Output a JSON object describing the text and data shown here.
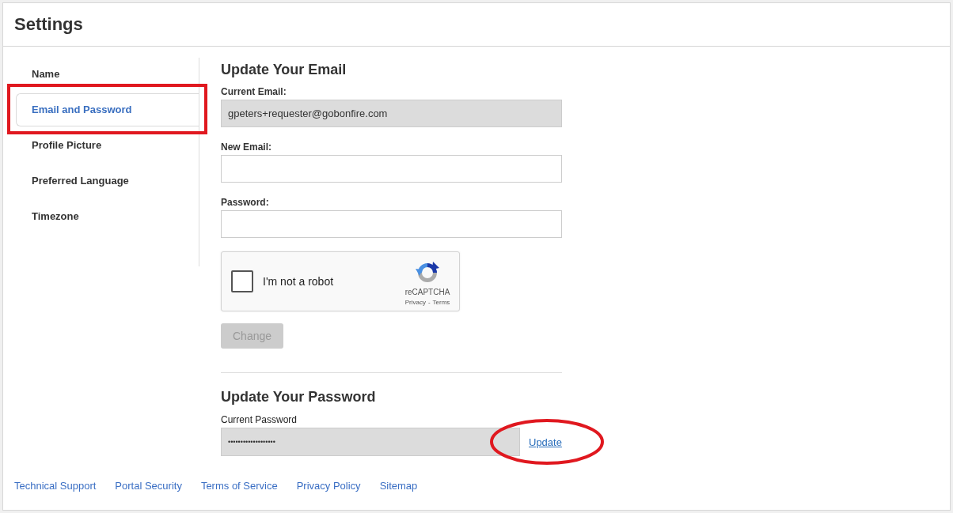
{
  "header": {
    "title": "Settings"
  },
  "sidebar": {
    "items": [
      {
        "label": "Name",
        "selected": false,
        "marked": false
      },
      {
        "label": "Email and Password",
        "selected": true,
        "marked": true
      },
      {
        "label": "Profile Picture",
        "selected": false,
        "marked": false
      },
      {
        "label": "Preferred Language",
        "selected": false,
        "marked": false
      },
      {
        "label": "Timezone",
        "selected": false,
        "marked": false
      }
    ]
  },
  "email_section": {
    "title": "Update Your Email",
    "fields": [
      {
        "label": "Current Email:",
        "value": "gpeters+requester@gobonfire.com",
        "readonly": true
      },
      {
        "label": "New Email:",
        "readonly": false
      },
      {
        "label": "Password:",
        "readonly": false
      }
    ],
    "captcha": {
      "label": "I'm not a robot",
      "checked": false,
      "brand": "reCAPTCHA",
      "links": [
        "Privacy",
        "Terms"
      ],
      "separator": "-"
    },
    "submit": {
      "label": "Change",
      "disabled": true
    }
  },
  "password_section": {
    "title": "Update Your Password",
    "field": {
      "label": "Current Password",
      "value": "•••••••••••••••••••",
      "readonly": true
    },
    "update_link": {
      "label": "Update",
      "marked": true
    }
  },
  "footer": {
    "links": [
      "Technical Support",
      "Portal Security",
      "Terms of Service",
      "Privacy Policy",
      "Sitemap"
    ]
  }
}
